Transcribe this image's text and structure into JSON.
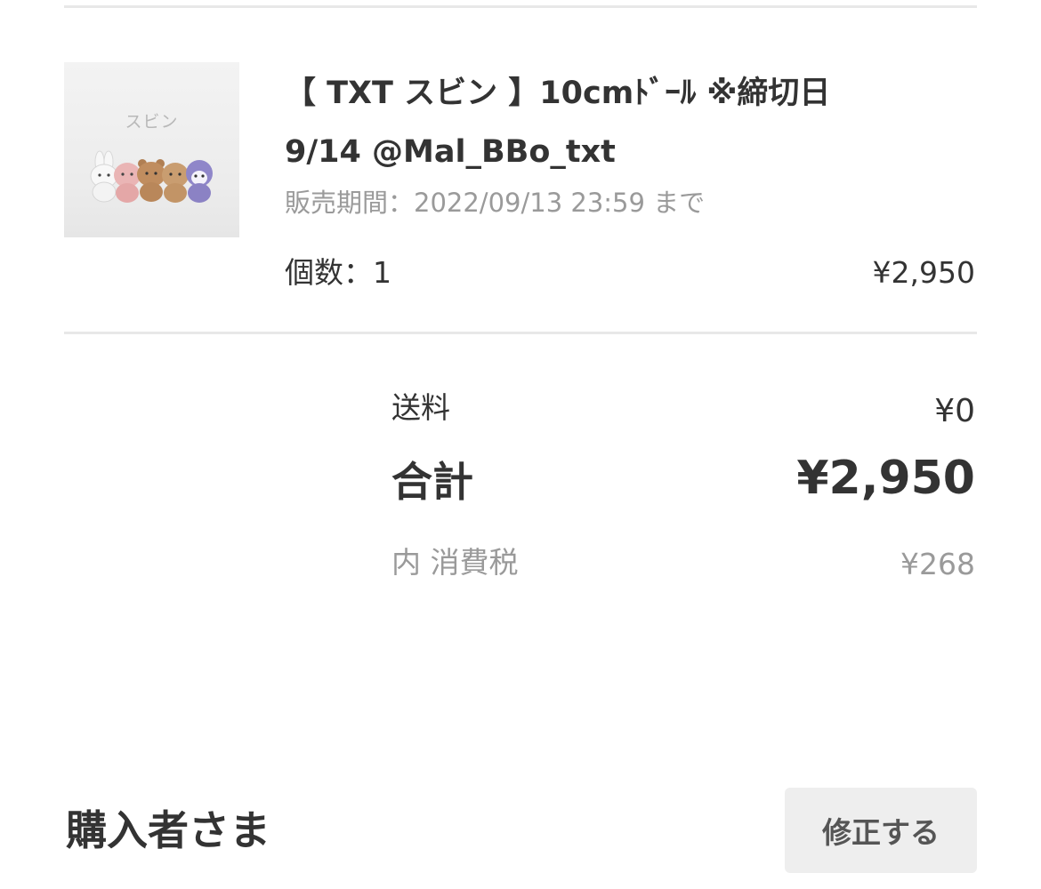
{
  "product": {
    "thumbnail_label": "スビン",
    "title_line1": "【 TXT スビン 】10cmﾄﾞｰﾙ ※締切日",
    "title_line2": "9/14 @Mal_BBo_txt",
    "sale_period": "販売期間：2022/09/13 23:59 まで",
    "quantity": "個数：1",
    "price": "¥2,950"
  },
  "summary": {
    "shipping_label": "送料",
    "shipping_value": "¥0",
    "total_label": "合計",
    "total_value": "¥2,950",
    "tax_label": "内 消費税",
    "tax_value": "¥268"
  },
  "buyer": {
    "heading": "購入者さま",
    "edit_label": "修正する"
  }
}
